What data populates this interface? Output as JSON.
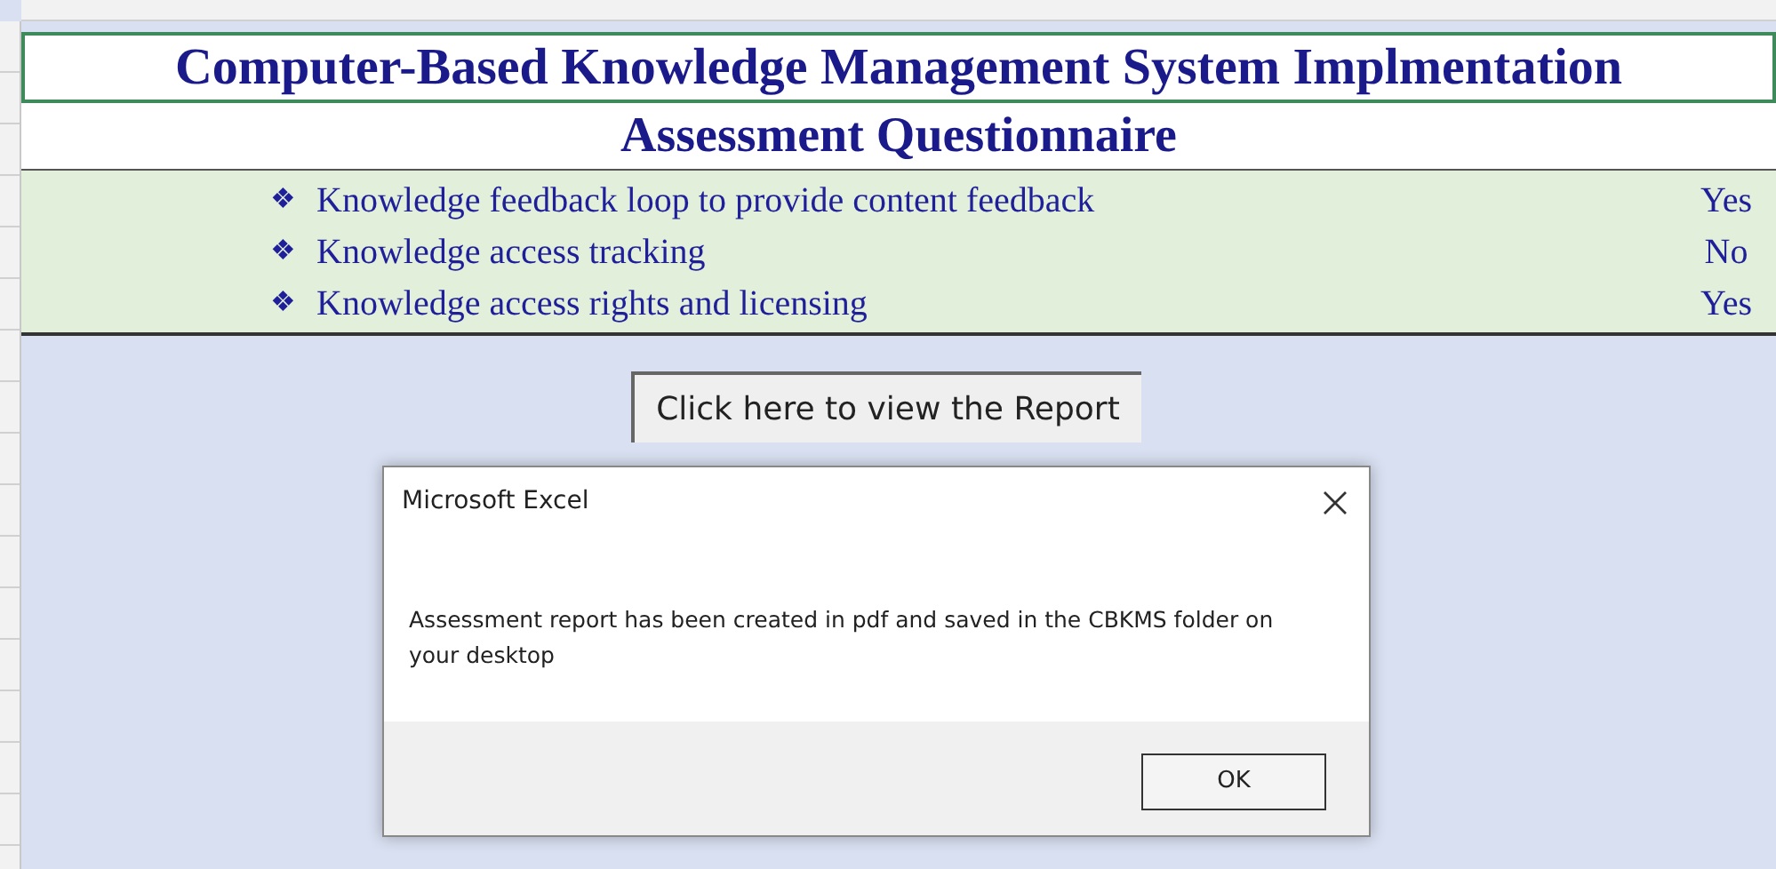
{
  "sheet": {
    "title": "Computer-Based Knowledge Management System Implmentation",
    "subtitle": "Assessment Questionnaire",
    "items": [
      {
        "bullet": "❖",
        "text": "Knowledge feedback loop to provide content feedback",
        "answer": "Yes"
      },
      {
        "bullet": "❖",
        "text": "Knowledge access tracking",
        "answer": "No"
      },
      {
        "bullet": "❖",
        "text": "Knowledge access rights and licensing",
        "answer": "Yes"
      }
    ],
    "report_button": "Click here to view the Report"
  },
  "dialog": {
    "title": "Microsoft Excel",
    "message": "Assessment report has been created in pdf and saved in the CBKMS folder on your desktop",
    "buttons": [
      "OK"
    ]
  }
}
